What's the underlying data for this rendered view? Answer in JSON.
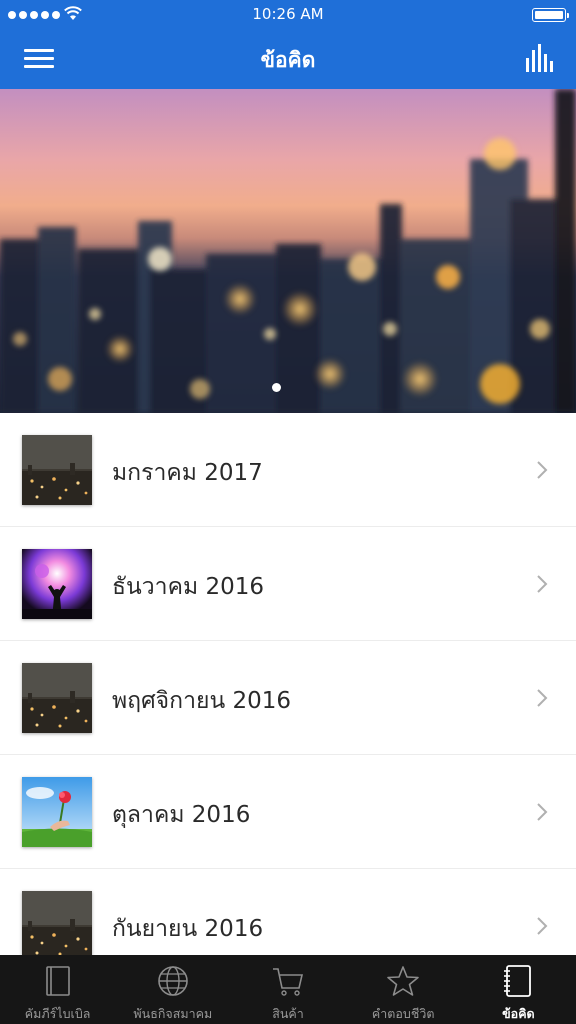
{
  "status_bar": {
    "time": "10:26 AM"
  },
  "nav": {
    "title": "ข้อคิด"
  },
  "list": {
    "items": [
      {
        "label": "มกราคม 2017",
        "thumb": "city-lights-image"
      },
      {
        "label": "ธันวาคม 2016",
        "thumb": "worship-concert-image"
      },
      {
        "label": "พฤศจิกายน 2016",
        "thumb": "city-lights-image"
      },
      {
        "label": "ตุลาคม 2016",
        "thumb": "flower-in-hand-image"
      },
      {
        "label": "กันยายน 2016",
        "thumb": "city-lights-image"
      }
    ]
  },
  "tabs": [
    {
      "label": "คัมภีร์ไบเบิล",
      "icon": "book-icon",
      "active": false
    },
    {
      "label": "พันธกิจสมาคม",
      "icon": "globe-icon",
      "active": false
    },
    {
      "label": "สินค้า",
      "icon": "cart-icon",
      "active": false
    },
    {
      "label": "คำตอบชีวิต",
      "icon": "star-icon",
      "active": false
    },
    {
      "label": "ข้อคิด",
      "icon": "notebook-icon",
      "active": true
    }
  ],
  "colors": {
    "accent": "#1f6fd8",
    "tab_bar": "#161616"
  }
}
